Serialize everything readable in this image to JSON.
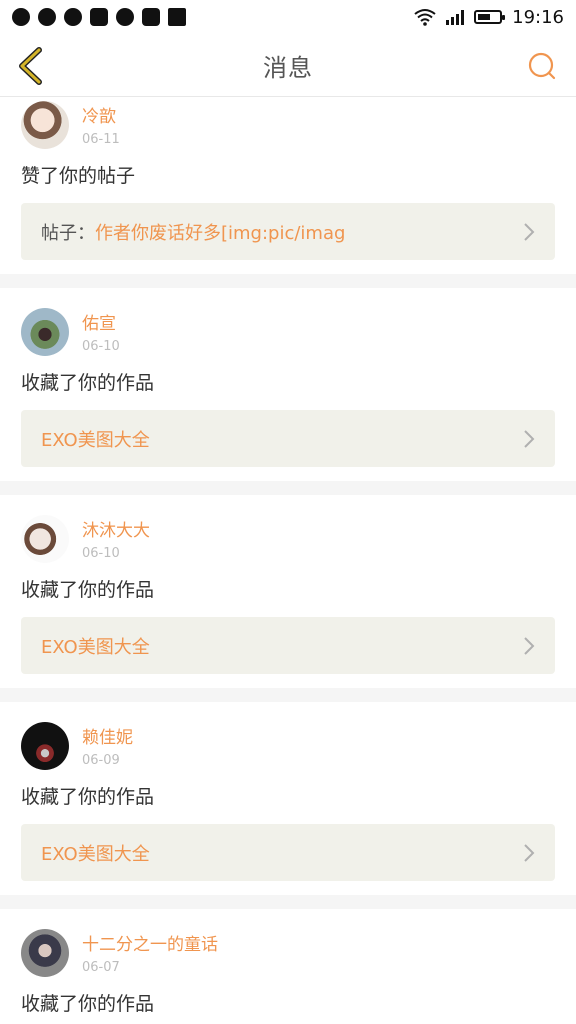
{
  "status_bar": {
    "time": "19:16",
    "battery_level": 0.6,
    "left_icons": [
      "messenger-icon",
      "sync-icon",
      "qq-icon",
      "image-icon",
      "globe-icon",
      "app-icon",
      "grid-icon"
    ]
  },
  "header": {
    "title": "消息",
    "back_icon": "chevron-left-icon",
    "search_icon": "search-icon"
  },
  "colors": {
    "accent": "#f0954f",
    "back_arrow": "#d4b428",
    "ref_bg": "#f1f1ea",
    "date": "#bdbdbd"
  },
  "messages": [
    {
      "username": "冷歆",
      "date": "06-11",
      "action": "赞了你的帖子",
      "ref_prefix": "帖子：",
      "ref_title": "作者你废话好多[img:pic/imag"
    },
    {
      "username": "佑宣",
      "date": "06-10",
      "action": "收藏了你的作品",
      "ref_prefix": "",
      "ref_title": "EXO美图大全"
    },
    {
      "username": "沐沐大大",
      "date": "06-10",
      "action": "收藏了你的作品",
      "ref_prefix": "",
      "ref_title": "EXO美图大全"
    },
    {
      "username": "赖佳妮",
      "date": "06-09",
      "action": "收藏了你的作品",
      "ref_prefix": "",
      "ref_title": "EXO美图大全"
    },
    {
      "username": "十二分之一的童话",
      "date": "06-07",
      "action": "收藏了你的作品",
      "ref_prefix": "",
      "ref_title": ""
    }
  ]
}
